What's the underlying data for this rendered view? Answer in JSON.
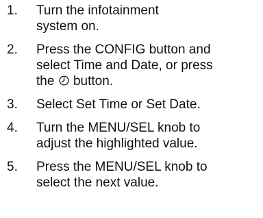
{
  "steps": [
    {
      "number": "1.",
      "text": "Turn the infotainment\nsystem on."
    },
    {
      "number": "2.",
      "text_before_icon": "Press the CONFIG button and\nselect Time and Date, or press\nthe ",
      "icon": "clock-icon",
      "text_after_icon": " button."
    },
    {
      "number": "3.",
      "text": "Select Set Time or Set Date."
    },
    {
      "number": "4.",
      "text": "Turn the MENU/SEL knob to\nadjust the highlighted value."
    },
    {
      "number": "5.",
      "text": "Press the MENU/SEL knob to\nselect the next value."
    }
  ]
}
